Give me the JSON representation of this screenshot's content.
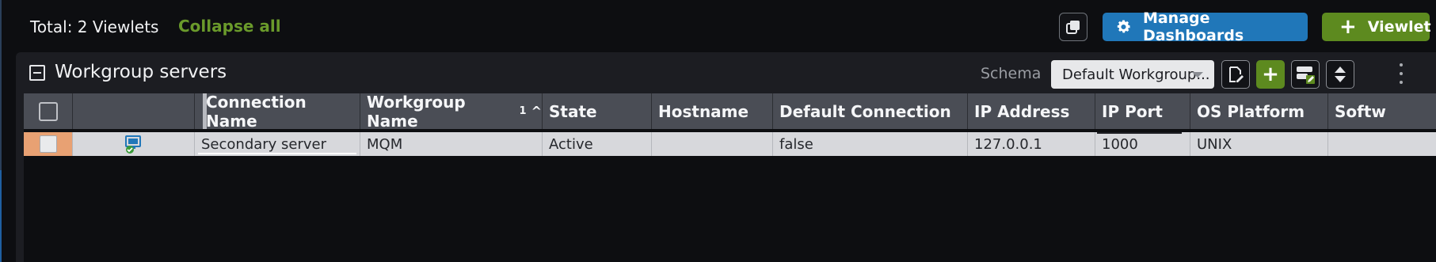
{
  "topbar": {
    "total_label": "Total: 2 Viewlets",
    "collapse_all": "Collapse all",
    "manage_dashboards": "Manage Dashboards",
    "viewlet_button": "Viewlet"
  },
  "panel": {
    "title": "Workgroup servers",
    "schema_label": "Schema",
    "schema_value": "Default Workgroup..."
  },
  "table": {
    "columns": [
      {
        "label": "Connection Name"
      },
      {
        "label": "Workgroup Name",
        "sort_index": "1",
        "sort_dir": "^"
      },
      {
        "label": "State"
      },
      {
        "label": "Hostname"
      },
      {
        "label": "Default Connection"
      },
      {
        "label": "IP Address"
      },
      {
        "label": "IP Port"
      },
      {
        "label": "OS Platform"
      },
      {
        "label": "Softw"
      }
    ],
    "rows": [
      {
        "connection_name": "Secondary server",
        "workgroup_name": "MQM",
        "state": "Active",
        "hostname": "",
        "default_connection": "false",
        "ip_address": "127.0.0.1",
        "ip_port": "1000",
        "os_platform": "UNIX",
        "software": ""
      }
    ]
  },
  "colors": {
    "accent_blue": "#2077b9",
    "accent_green": "#5d8a1f",
    "collapse_link": "#6a9a2b",
    "row_highlight": "#e8a173"
  },
  "icons": [
    "copy-icon",
    "gear-icon",
    "plus-icon",
    "collapse-square-icon",
    "edit-document-icon",
    "server-edit-icon",
    "expand-collapse-icon",
    "kebab-menu-icon",
    "server-connected-icon"
  ]
}
